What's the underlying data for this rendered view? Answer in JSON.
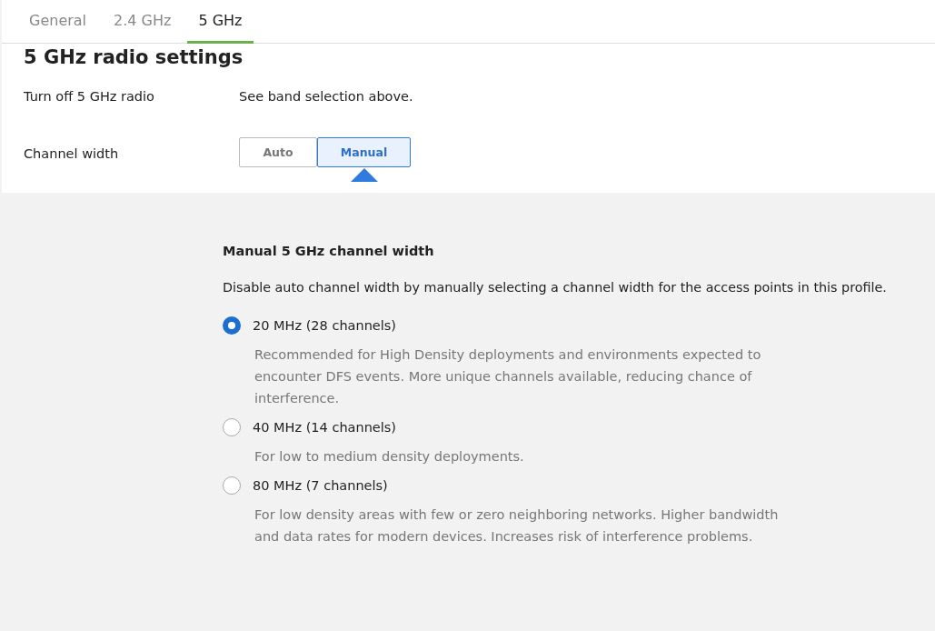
{
  "tabs": [
    {
      "label": "General",
      "selected": false
    },
    {
      "label": "2.4 GHz",
      "selected": false
    },
    {
      "label": "5 GHz",
      "selected": true
    }
  ],
  "settings": {
    "title": "5 GHz radio settings",
    "rows": [
      {
        "label": "Turn off 5 GHz radio",
        "kind": "text",
        "value": "See band selection above."
      },
      {
        "label": "Channel width",
        "kind": "segmented",
        "options": [
          {
            "label": "Auto",
            "selected": false
          },
          {
            "label": "Manual",
            "selected": true
          }
        ]
      }
    ]
  },
  "manual_panel": {
    "title": "Manual 5 GHz channel width",
    "description": "Disable auto channel width by manually selecting a channel width for the access points in this profile.",
    "options": [
      {
        "label": "20 MHz (28 channels)",
        "selected": true,
        "description": "Recommended for High Density deployments and environments expected to encounter DFS events. More unique channels available, reducing chance of interference."
      },
      {
        "label": "40 MHz (14 channels)",
        "selected": false,
        "description": "For low to medium density deployments."
      },
      {
        "label": "80 MHz (7 channels)",
        "selected": false,
        "description": "For low density areas with few or zero neighboring networks. Higher bandwidth and data rates for modern devices. Increases risk of interference problems."
      }
    ]
  }
}
